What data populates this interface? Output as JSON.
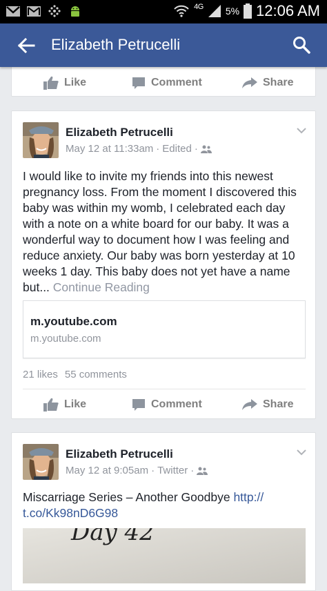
{
  "status_bar": {
    "network": "4G",
    "battery": "5%",
    "time": "12:06 AM",
    "icons": [
      "gmail-icon",
      "email-icon",
      "app-dots-icon",
      "android-icon",
      "wifi-icon",
      "signal-icon",
      "battery-icon"
    ]
  },
  "app_bar": {
    "title": "Elizabeth Petrucelli",
    "back_icon": "arrow-back-icon",
    "search_icon": "search-icon",
    "color": "#3b5998"
  },
  "actions": {
    "like": "Like",
    "comment": "Comment",
    "share": "Share"
  },
  "posts": [
    {
      "author": "Elizabeth Petrucelli",
      "time": "May 12 at 11:33am",
      "edited": "Edited",
      "body": "I would like to invite my friends into this newest pregnancy loss. From the moment I discovered this baby was within my womb, I celebrated each day with a note on a white board for our baby. It was a wonderful way to document how I was feeling and reduce anxiety. Our baby was born yesterday at 10 weeks 1 day. This baby does not yet have a name but...",
      "continue": "Continue Reading",
      "link_title": "m.youtube.com",
      "link_domain": "m.youtube.com",
      "likes": "21 likes",
      "comments": "55 comments"
    },
    {
      "author": "Elizabeth Petrucelli",
      "time": "May 12 at 9:05am",
      "via": "Twitter",
      "body": "Miscarriage Series – Another Goodbye",
      "url_part1": "http://",
      "url_part2": "t.co/Kk98nD6G98",
      "photo_text": "Day 42"
    }
  ]
}
